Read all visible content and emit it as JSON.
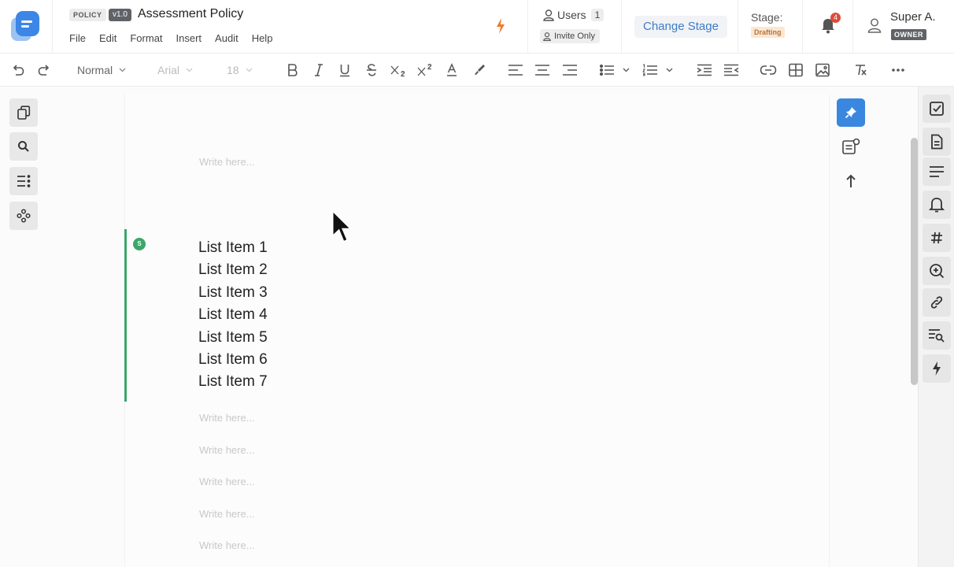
{
  "header": {
    "type_badge": "POLICY",
    "version_badge": "v1.0",
    "title": "Assessment Policy",
    "menu": [
      "File",
      "Edit",
      "Format",
      "Insert",
      "Audit",
      "Help"
    ],
    "users_label": "Users",
    "users_count": "1",
    "invite_label": "Invite Only",
    "change_stage_label": "Change Stage",
    "stage_label": "Stage:",
    "stage_value": "Drafting",
    "notifications_count": "4",
    "user_name": "Super A.",
    "user_role": "OWNER"
  },
  "toolbar": {
    "style_select": "Normal",
    "font_select": "Arial",
    "size_select": "18"
  },
  "editor": {
    "placeholder": "Write here...",
    "section_marker": "S",
    "list_items": [
      "List Item 1",
      "List Item 2",
      "List Item 3",
      "List Item 4",
      "List Item 5",
      "List Item 6",
      "List Item 7"
    ]
  },
  "colors": {
    "accent_blue": "#3a87e0",
    "link_blue": "#3d7cc9",
    "section_green": "#3aa66a",
    "notification_red": "#e04a3b",
    "drafting_bg": "#fbe7d3"
  }
}
